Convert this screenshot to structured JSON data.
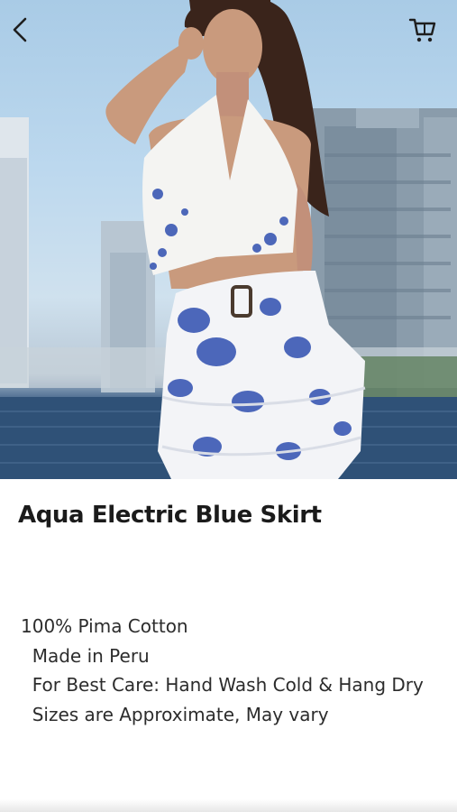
{
  "header": {
    "back_icon": "chevron-left-icon",
    "cart_icon": "shopping-cart-icon"
  },
  "product": {
    "title": "Aqua Electric Blue Skirt",
    "description": "100% Pima Cotton\n  Made in Peru\n  For Best Care: Hand Wash Cold & Hang Dry\n  Sizes are Approximate, May vary"
  },
  "colors": {
    "print_blue": "#2f4fb0",
    "text": "#1b1b1b",
    "water": "#2c4e74",
    "sky": "#a9cbe6"
  }
}
